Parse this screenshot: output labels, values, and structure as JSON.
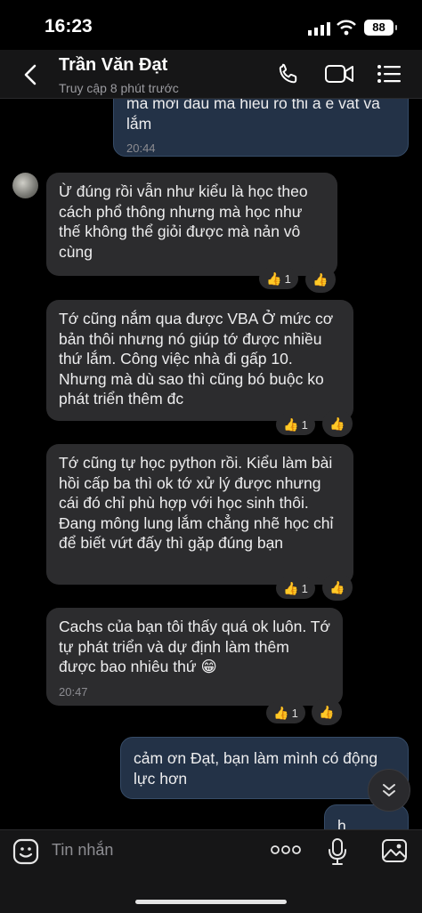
{
  "status": {
    "time": "16:23",
    "battery": "88"
  },
  "header": {
    "name": "Trần Văn Đạt",
    "subtitle": "Truy cập 8 phút trước"
  },
  "messages": [
    {
      "text": "ma mơi dau ma hieu ro thi a e vat va lắm",
      "time": "20:44"
    },
    {
      "text": "Ừ đúng rồi vẫn như kiểu là học theo cách phổ thông nhưng mà học như thế không thể giỏi được mà nản vô cùng",
      "react_count": "1"
    },
    {
      "text": "Tớ cũng nắm qua được VBA Ở mức cơ bản thôi nhưng nó giúp tớ được nhiều thứ lắm. Công việc nhà đi gấp 10. Nhưng mà dù sao thì cũng bó buộc ko phát triển thêm đc",
      "react_count": "1"
    },
    {
      "text": "Tớ cũng tự học python rồi. Kiểu làm bài hồi cấp ba thì ok tớ xử lý được nhưng cái đó chỉ phù hợp với học sinh thôi. Đang mông lung lắm chẳng nhẽ học chỉ để biết vứt đấy thì gặp đúng bạn",
      "react_count": "1"
    },
    {
      "text": "Cachs của bạn tôi thấy quá ok luôn. Tớ tự phát triển và dự định làm thêm được bao nhiêu thứ 😁",
      "time": "20:47",
      "react_count": "1"
    },
    {
      "text": "cảm ơn Đạt, bạn làm mình có động lực hơn"
    },
    {
      "text": "h"
    }
  ],
  "input": {
    "placeholder": "Tin nhắn"
  },
  "icons": [
    "back-icon",
    "phone-icon",
    "video-icon",
    "menu-icon",
    "thumbs-up-icon",
    "scroll-down-icon",
    "emoji-icon",
    "more-icon",
    "mic-icon",
    "image-icon"
  ]
}
